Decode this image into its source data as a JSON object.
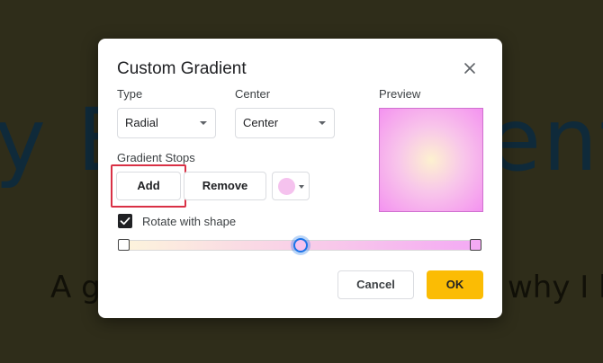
{
  "background": {
    "heading_left": "y B",
    "heading_right": "ent",
    "subtitle_left": "A g",
    "subtitle_right": "why I l"
  },
  "dialog": {
    "title": "Custom Gradient",
    "type_label": "Type",
    "type_value": "Radial",
    "center_label": "Center",
    "center_value": "Center",
    "preview_label": "Preview",
    "stops_label": "Gradient Stops",
    "add_label": "Add",
    "remove_label": "Remove",
    "stop_color": "#f5c2ee",
    "rotate_label": "Rotate with shape",
    "rotate_checked": true,
    "cancel_label": "Cancel",
    "ok_label": "OK"
  },
  "colors": {
    "accent": "#fbbc04",
    "highlight": "#d93045",
    "selection": "#1a73e8"
  }
}
